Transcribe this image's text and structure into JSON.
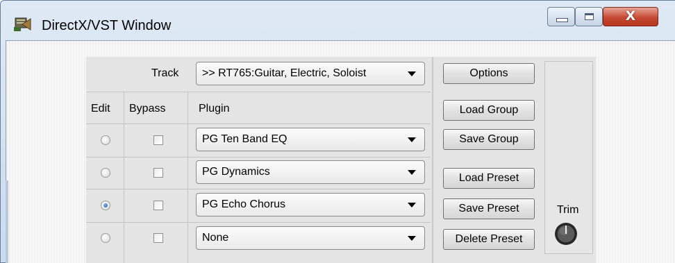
{
  "window": {
    "title": "DirectX/VST Window",
    "close_glyph": "X",
    "icons": {
      "app": "plugin-app-icon",
      "minimize": "minimize-icon",
      "maximize": "maximize-icon",
      "close": "close-icon"
    }
  },
  "panel": {
    "track_label": "Track",
    "track_value": ">> RT765:Guitar, Electric, Soloist",
    "headers": {
      "edit": "Edit",
      "bypass": "Bypass",
      "plugin": "Plugin"
    },
    "rows": [
      {
        "edit_selected": false,
        "bypass_checked": false,
        "plugin": "PG Ten Band EQ"
      },
      {
        "edit_selected": false,
        "bypass_checked": false,
        "plugin": "PG Dynamics"
      },
      {
        "edit_selected": true,
        "bypass_checked": false,
        "plugin": "PG Echo Chorus"
      },
      {
        "edit_selected": false,
        "bypass_checked": false,
        "plugin": "None"
      }
    ]
  },
  "buttons": {
    "options": "Options",
    "load_group": "Load Group",
    "save_group": "Save Group",
    "load_preset": "Load Preset",
    "save_preset": "Save Preset",
    "delete_preset": "Delete Preset"
  },
  "trim": {
    "label": "Trim",
    "icon": "trim-knob-icon"
  },
  "colors": {
    "radio_selected": "#1c5fa6",
    "close_button": "#c54a33",
    "titlebar": "#dfe9f5"
  }
}
